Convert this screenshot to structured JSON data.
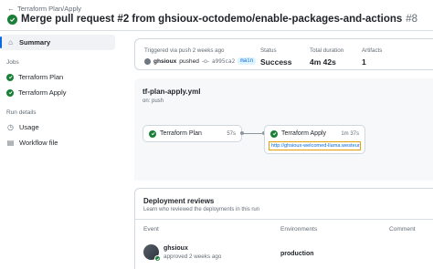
{
  "header": {
    "back_label": "Terraform Plan/Apply",
    "title": "Merge pull request #2 from ghsioux-octodemo/enable-packages-and-actions",
    "run_number": "#8"
  },
  "sidebar": {
    "summary_label": "Summary",
    "jobs_heading": "Jobs",
    "jobs": [
      "Terraform Plan",
      "Terraform Apply"
    ],
    "run_details_heading": "Run details",
    "details": [
      "Usage",
      "Workflow file"
    ]
  },
  "summary": {
    "triggered": "Triggered via push 2 weeks ago",
    "actor": "ghsioux",
    "action": "pushed",
    "commit": "a995ca2",
    "branch": "main",
    "status_label": "Status",
    "status": "Success",
    "duration_label": "Total duration",
    "duration": "4m 42s",
    "artifacts_label": "Artifacts",
    "artifacts": "1"
  },
  "workflow": {
    "file": "tf-plan-apply.yml",
    "trigger": "on: push",
    "jobs": [
      {
        "name": "Terraform Plan",
        "duration": "57s"
      },
      {
        "name": "Terraform Apply",
        "duration": "1m 37s",
        "url": "http://ghsioux-welcomed-llama.westeur..."
      }
    ]
  },
  "reviews": {
    "title": "Deployment reviews",
    "subtitle": "Learn who reviewed the deployments in this run",
    "columns": [
      "Event",
      "Environments",
      "Comment"
    ],
    "rows": [
      {
        "user": "ghsioux",
        "event": "approved 2 weeks ago",
        "environment": "production",
        "comment": ""
      }
    ]
  },
  "colors": {
    "success": "#1a7f37",
    "link": "#0969da",
    "highlight_border": "#e3a008"
  }
}
